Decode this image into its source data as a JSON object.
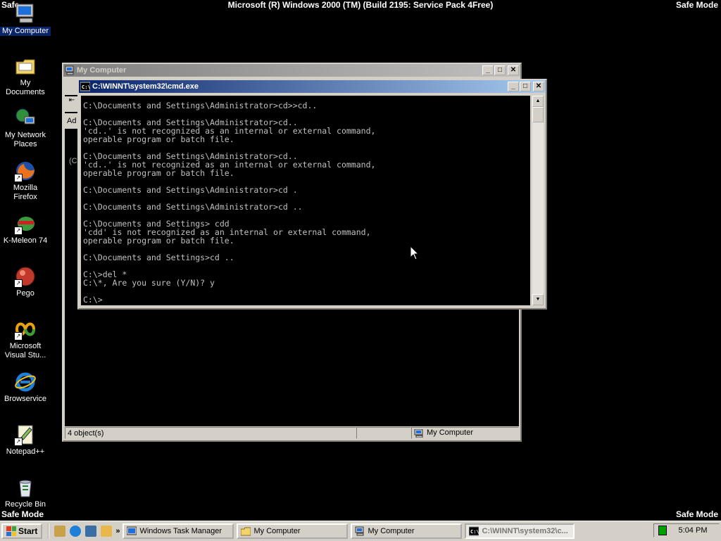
{
  "os_banner": "Microsoft (R) Windows 2000 (TM) (Build 2195: Service Pack 4Free)",
  "safe_mode_label": "Safe Mode",
  "safe_mode_top_left": "Safe",
  "desktop_icons": [
    {
      "label": "My Computer",
      "icon": "my-computer-icon"
    },
    {
      "label": "My Documents",
      "icon": "folder-icon"
    },
    {
      "label": "My Network Places",
      "icon": "network-places-icon"
    },
    {
      "label": "Mozilla Firefox",
      "icon": "firefox-icon"
    },
    {
      "label": "K-Meleon 74",
      "icon": "k-meleon-icon"
    },
    {
      "label": "Pego",
      "icon": "pego-icon"
    },
    {
      "label": "Microsoft Visual Stu...",
      "icon": "visual-studio-icon"
    },
    {
      "label": "Browservice",
      "icon": "internet-explorer-icon"
    },
    {
      "label": "Notepad++",
      "icon": "notepad-plus-plus-icon"
    },
    {
      "label": "Recycle Bin",
      "icon": "recycle-bin-icon"
    }
  ],
  "my_computer_window": {
    "title": "My Computer",
    "toolbar_fragment": "Ad",
    "left_fragment": "(C",
    "status_objects": "4 object(s)",
    "status_location": "My Computer"
  },
  "cmd_window": {
    "title": "C:\\WINNT\\system32\\cmd.exe",
    "output": "C:\\Documents and Settings\\Administrator>cd>>cd..\n\nC:\\Documents and Settings\\Administrator>cd..\n'cd..' is not recognized as an internal or external command,\noperable program or batch file.\n\nC:\\Documents and Settings\\Administrator>cd..\n'cd..' is not recognized as an internal or external command,\noperable program or batch file.\n\nC:\\Documents and Settings\\Administrator>cd .\n\nC:\\Documents and Settings\\Administrator>cd ..\n\nC:\\Documents and Settings> cdd\n'cdd' is not recognized as an internal or external command,\noperable program or batch file.\n\nC:\\Documents and Settings>cd ..\n\nC:\\>del *\nC:\\*, Are you sure (Y/N)? y\n\nC:\\>"
  },
  "taskbar": {
    "start_label": "Start",
    "quick_launch_more": "»",
    "buttons": [
      {
        "label": "Windows Task Manager",
        "icon": "task-manager-icon"
      },
      {
        "label": "My Computer",
        "icon": "folder-icon"
      },
      {
        "label": "My Computer",
        "icon": "my-computer-icon"
      },
      {
        "label": "C:\\WINNT\\system32\\c...",
        "icon": "cmd-icon",
        "active": true
      }
    ],
    "clock": "5:04 PM"
  }
}
